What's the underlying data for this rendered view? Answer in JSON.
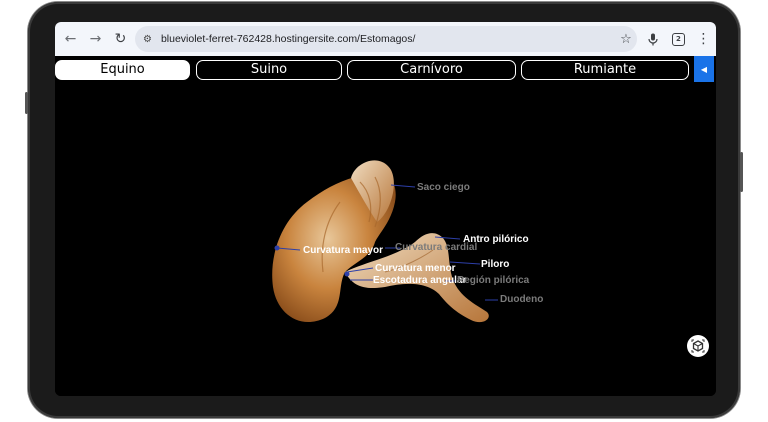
{
  "browser": {
    "url": "blueviolet-ferret-762428.hostingersite.com/Estomagos/",
    "tab_count": "2"
  },
  "nav": {
    "tabs": [
      {
        "label": "Equino",
        "active": true
      },
      {
        "label": "Suino",
        "active": false
      },
      {
        "label": "Carnívoro",
        "active": false
      },
      {
        "label": "Rumiante",
        "active": false
      }
    ]
  },
  "labels": {
    "saco_ciego": "Saco ciego",
    "antro_pilorico": "Antro pilórico",
    "cardias": "Curvatura cardial",
    "curvatura_mayor": "Curvatura mayor",
    "piloro": "Piloro",
    "curvatura_menor": "Curvatura menor",
    "escotadura": "Escotadura angular",
    "region_pilorica": "Región pilórica",
    "duodeno": "Duodeno"
  },
  "colors": {
    "accent": "#1a73e8",
    "screen_bg": "#000000",
    "tissue": "#c9843e"
  }
}
